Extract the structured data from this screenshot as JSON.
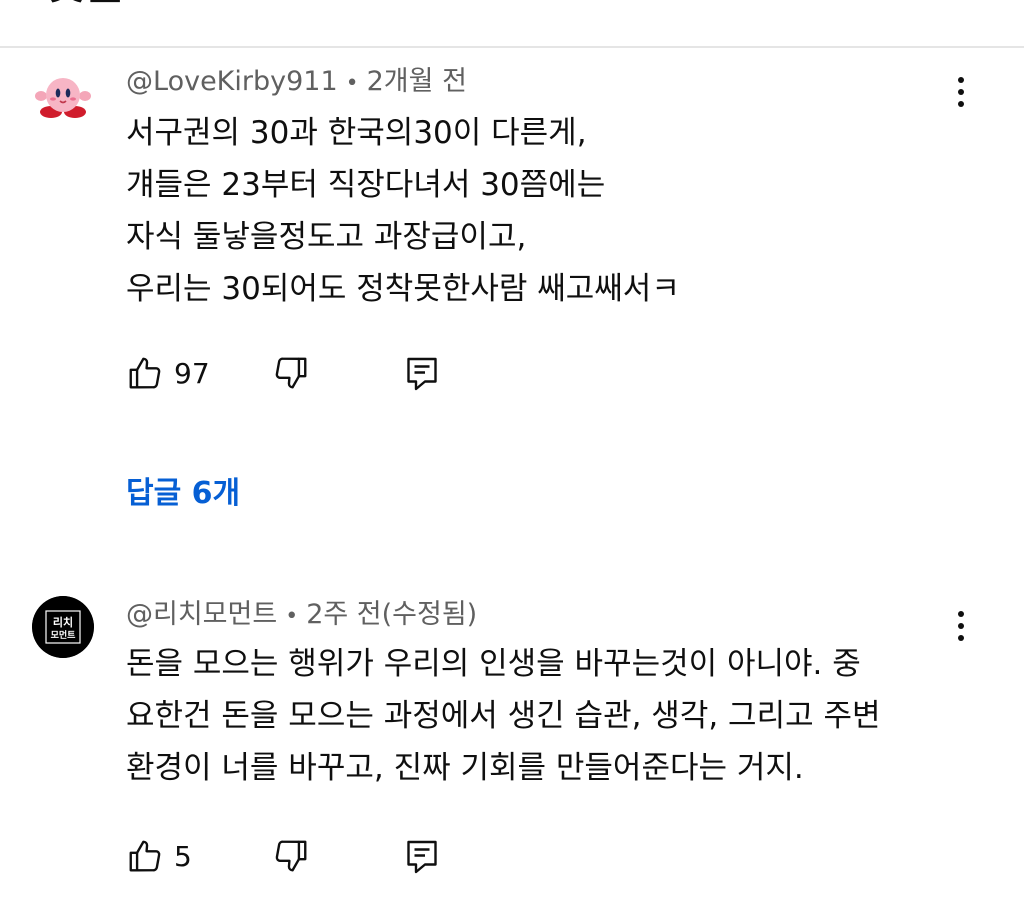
{
  "header": {
    "title": "댓글"
  },
  "comments": [
    {
      "author": "@LoveKirby911",
      "time": "2개월 전",
      "lines": [
        "서구권의 30과 한국의30이 다른게,",
        "걔들은 23부터 직장다녀서 30쯤에는",
        "자식 둘낳을정도고 과장급이고,",
        "우리는 30되어도 정착못한사람 쌔고쌔서ㅋ"
      ],
      "likes": "97",
      "replies_label": "답글 6개",
      "avatar_icon": "kirby-avatar"
    },
    {
      "author": "@리치모먼트",
      "time": "2주 전(수정됨)",
      "lines": [
        "돈을 모으는 행위가 우리의 인생을 바꾸는것이 아니야. 중",
        "요한건 돈을 모으는 과정에서 생긴 습관, 생각, 그리고 주변",
        "환경이 너를 바꾸고, 진짜 기회를 만들어준다는 거지."
      ],
      "likes": "5",
      "avatar_text": [
        "리치",
        "모먼트"
      ],
      "avatar_icon": "rich-moment-logo"
    }
  ],
  "colors": {
    "accent": "#065fd4",
    "meta": "#606060",
    "text": "#0f0f0f",
    "divider": "#e5e5e5"
  }
}
